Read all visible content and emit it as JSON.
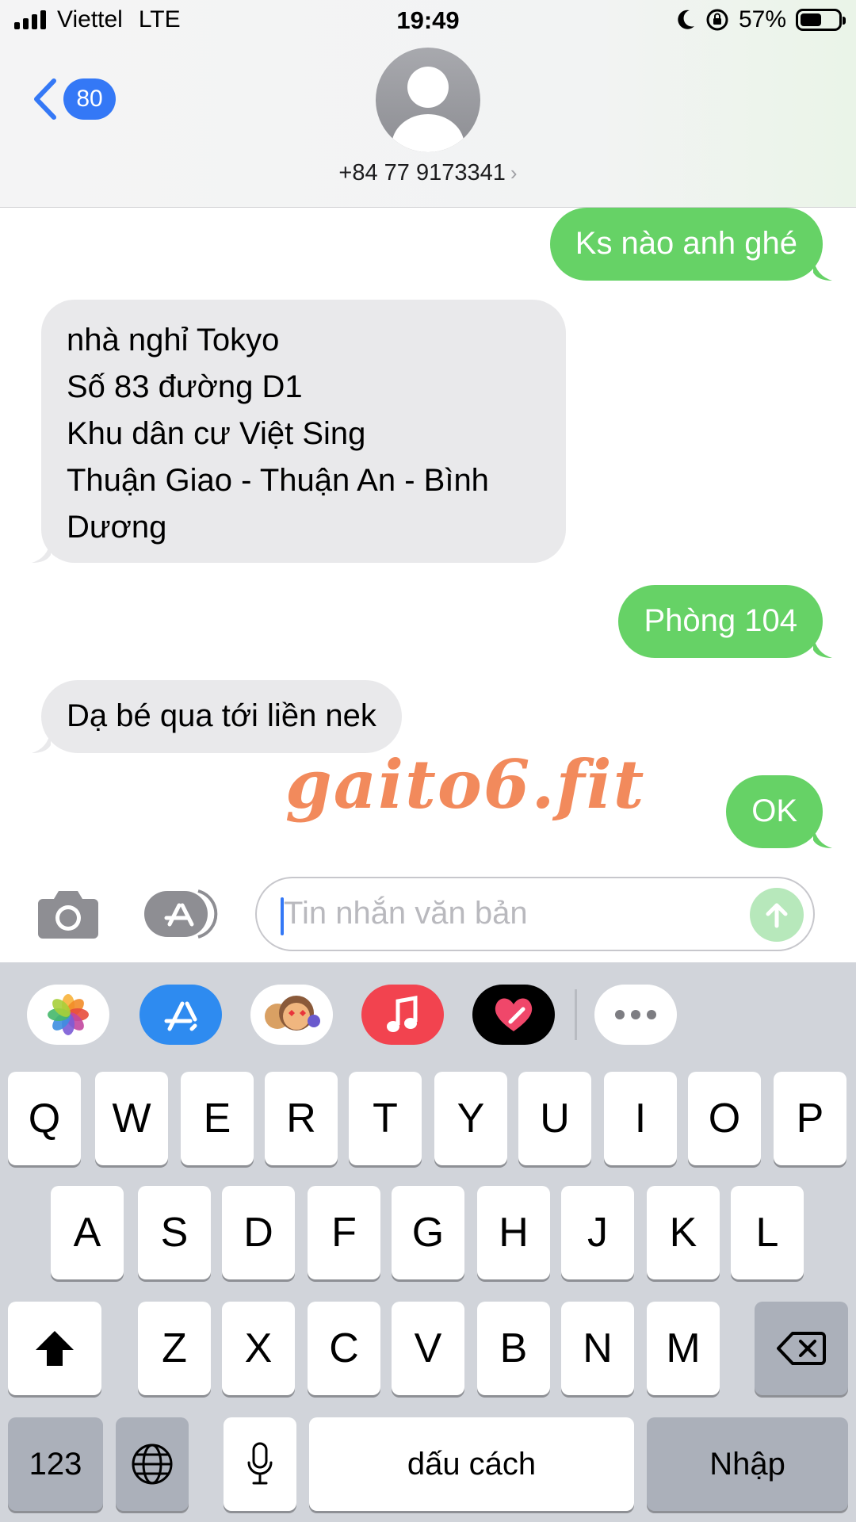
{
  "status_bar": {
    "carrier": "Viettel",
    "network": "LTE",
    "time": "19:49",
    "battery_text": "57%",
    "battery_level": 0.57
  },
  "header": {
    "back_badge": "80",
    "contact_number": "+84 77 9173341",
    "chevron": "›"
  },
  "messages": [
    {
      "direction": "sent",
      "lines": [
        "Ks nào anh ghé"
      ]
    },
    {
      "direction": "received",
      "lines": [
        "nhà nghỉ Tokyo",
        "Số 83 đường D1",
        "Khu dân cư Việt Sing",
        "Thuận Giao - Thuận An - Bình",
        "Dương"
      ]
    },
    {
      "direction": "sent",
      "lines": [
        "Phòng 104"
      ]
    },
    {
      "direction": "received",
      "lines": [
        "Dạ bé qua tới liền nek"
      ]
    },
    {
      "direction": "sent",
      "lines": [
        "OK"
      ]
    }
  ],
  "watermark": "gaito6.fit",
  "composer": {
    "placeholder": "Tin nhắn văn bản"
  },
  "app_strip": {
    "icons": [
      "photos-icon",
      "app-store-icon",
      "memoji-icon",
      "music-icon",
      "digital-touch-icon",
      "more-icon"
    ]
  },
  "keyboard": {
    "row1": [
      "Q",
      "W",
      "E",
      "R",
      "T",
      "Y",
      "U",
      "I",
      "O",
      "P"
    ],
    "row2": [
      "A",
      "S",
      "D",
      "F",
      "G",
      "H",
      "J",
      "K",
      "L"
    ],
    "row3": [
      "Z",
      "X",
      "C",
      "V",
      "B",
      "N",
      "M"
    ],
    "numbers_key": "123",
    "space_key": "dấu cách",
    "return_key": "Nhập"
  },
  "colors": {
    "sent_bubble": "#66d266",
    "received_bubble": "#e9e9eb",
    "accent": "#3478f6",
    "watermark": "#f28a5c"
  }
}
